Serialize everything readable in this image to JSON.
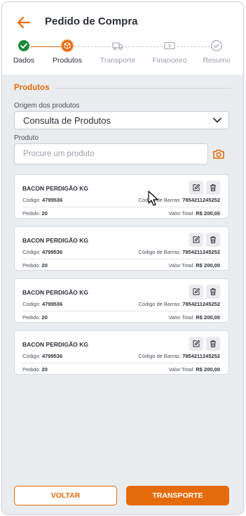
{
  "header": {
    "title": "Pedido de Compra",
    "back_icon": "arrow-left-icon"
  },
  "steps": [
    {
      "label": "Dados",
      "status": "done",
      "icon": "check-circle-icon"
    },
    {
      "label": "Produtos",
      "status": "active",
      "icon": "box-icon"
    },
    {
      "label": "Transporte",
      "status": "pending",
      "icon": "truck-icon"
    },
    {
      "label": "Financeiro",
      "status": "pending",
      "icon": "money-icon"
    },
    {
      "label": "Resumo",
      "status": "pending",
      "icon": "check-circle-icon"
    }
  ],
  "section": {
    "title": "Produtos"
  },
  "origin": {
    "label": "Origem dos produtos",
    "value": "Consulta de Produtos"
  },
  "product": {
    "label": "Produto",
    "placeholder": "Procure um produto"
  },
  "cards": [
    {
      "name": "BACON PERDIGÃO KG",
      "code_label": "Código:",
      "code": "4799536",
      "barcode_label": "Código de Barras:",
      "barcode": "7854211245252",
      "qty_label": "Pedido:",
      "qty": "20",
      "total_label": "Valor Total:",
      "total": "R$ 200,00"
    },
    {
      "name": "BACON PERDIGÃO KG",
      "code_label": "Código:",
      "code": "4799536",
      "barcode_label": "Código de Barras:",
      "barcode": "7854211245252",
      "qty_label": "Pedido:",
      "qty": "20",
      "total_label": "Valor Total:",
      "total": "R$ 200,00"
    },
    {
      "name": "BACON PERDIGÃO KG",
      "code_label": "Código:",
      "code": "4799536",
      "barcode_label": "Código de Barras:",
      "barcode": "7854211245252",
      "qty_label": "Pedido:",
      "qty": "20",
      "total_label": "Valor Total:",
      "total": "R$ 200,00"
    },
    {
      "name": "BACON PERDIGÃO KG",
      "code_label": "Código:",
      "code": "4799536",
      "barcode_label": "Código de Barras:",
      "barcode": "7854211245252",
      "qty_label": "Pedido:",
      "qty": "20",
      "total_label": "Valor Total:",
      "total": "R$ 200,00"
    }
  ],
  "footer": {
    "back_label": "VOLTAR",
    "next_label": "TRANSPORTE"
  },
  "colors": {
    "accent": "#e56b0a",
    "done": "#1f8a3a",
    "background": "#eaedf0"
  }
}
